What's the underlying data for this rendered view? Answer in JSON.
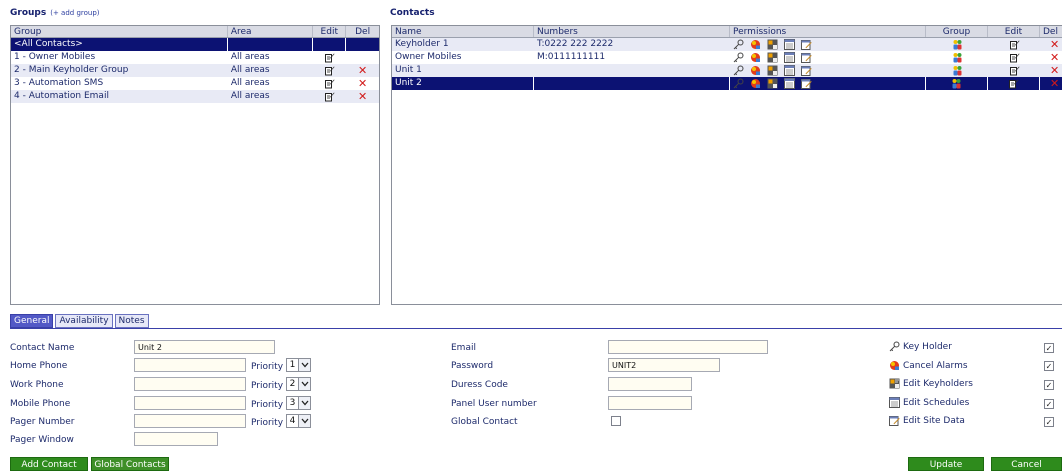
{
  "groups": {
    "title": "Groups",
    "add_link": "(+ add group)",
    "columns": {
      "group": "Group",
      "area": "Area",
      "edit": "Edit",
      "del": "Del"
    },
    "rows": [
      {
        "name": "<All Contacts>",
        "area": "",
        "editable": false,
        "deletable": false
      },
      {
        "name": "1 - Owner Mobiles",
        "area": "All areas",
        "editable": true,
        "deletable": false
      },
      {
        "name": "2 - Main Keyholder Group",
        "area": "All areas",
        "editable": true,
        "deletable": true
      },
      {
        "name": "3 - Automation SMS",
        "area": "All areas",
        "editable": true,
        "deletable": true
      },
      {
        "name": "4 - Automation Email",
        "area": "All areas",
        "editable": true,
        "deletable": true
      }
    ]
  },
  "contacts": {
    "title": "Contacts",
    "columns": {
      "name": "Name",
      "numbers": "Numbers",
      "permissions": "Permissions",
      "group": "Group",
      "edit": "Edit",
      "del": "Del"
    },
    "rows": [
      {
        "name": "Keyholder 1",
        "numbers": "T:0222 222 2222"
      },
      {
        "name": "Owner Mobiles",
        "numbers": "M:0111111111"
      },
      {
        "name": "Unit 1",
        "numbers": ""
      },
      {
        "name": "Unit 2",
        "numbers": ""
      }
    ]
  },
  "tabs": [
    "General",
    "Availability",
    "Notes"
  ],
  "form": {
    "contact_name_label": "Contact Name",
    "contact_name_value": "Unit 2",
    "home_phone_label": "Home Phone",
    "work_phone_label": "Work Phone",
    "mobile_phone_label": "Mobile Phone",
    "pager_number_label": "Pager Number",
    "pager_window_label": "Pager Window",
    "priority_label": "Priority",
    "priorities": [
      "1",
      "2",
      "3",
      "4"
    ],
    "email_label": "Email",
    "password_label": "Password",
    "password_value": "UNIT2",
    "duress_label": "Duress Code",
    "panel_user_label": "Panel User number",
    "global_contact_label": "Global Contact",
    "key_holder_label": "Key Holder",
    "cancel_alarms_label": "Cancel Alarms",
    "edit_keyholders_label": "Edit Keyholders",
    "edit_schedules_label": "Edit Schedules",
    "edit_site_data_label": "Edit Site Data",
    "checkmark": "✓"
  },
  "buttons": {
    "add_contact": "Add Contact",
    "global_contacts": "Global Contacts",
    "update": "Update",
    "cancel": "Cancel"
  },
  "colors": {
    "selected_row": "#0c1273",
    "button_green": "#2e8b1c",
    "delete_red": "#d21a1a"
  }
}
